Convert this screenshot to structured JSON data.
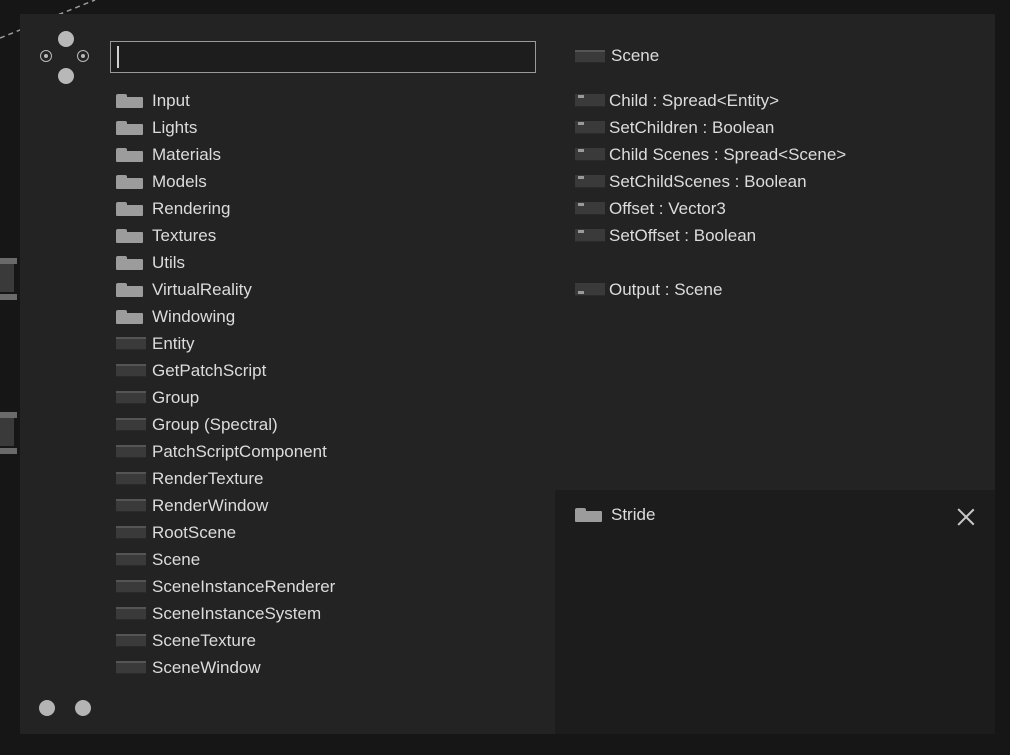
{
  "search": {
    "value": "",
    "placeholder": ""
  },
  "categories": [
    {
      "label": "Input"
    },
    {
      "label": "Lights"
    },
    {
      "label": "Materials"
    },
    {
      "label": "Models"
    },
    {
      "label": "Rendering"
    },
    {
      "label": "Textures"
    },
    {
      "label": "Utils"
    },
    {
      "label": "VirtualReality"
    },
    {
      "label": "Windowing"
    }
  ],
  "nodes": [
    {
      "label": "Entity"
    },
    {
      "label": "GetPatchScript"
    },
    {
      "label": "Group"
    },
    {
      "label": "Group (Spectral)"
    },
    {
      "label": "PatchScriptComponent"
    },
    {
      "label": "RenderTexture"
    },
    {
      "label": "RenderWindow"
    },
    {
      "label": "RootScene"
    },
    {
      "label": "Scene"
    },
    {
      "label": "SceneInstanceRenderer"
    },
    {
      "label": "SceneInstanceSystem"
    },
    {
      "label": "SceneTexture"
    },
    {
      "label": "SceneWindow"
    }
  ],
  "preview": {
    "title": "Scene",
    "inputs": [
      {
        "label": "Child : Spread<Entity>"
      },
      {
        "label": "SetChildren : Boolean"
      },
      {
        "label": "Child Scenes : Spread<Scene>"
      },
      {
        "label": "SetChildScenes : Boolean"
      },
      {
        "label": "Offset : Vector3"
      },
      {
        "label": "SetOffset : Boolean"
      }
    ],
    "outputs": [
      {
        "label": "Output : Scene"
      }
    ]
  },
  "info_panel": {
    "category": "Stride"
  }
}
